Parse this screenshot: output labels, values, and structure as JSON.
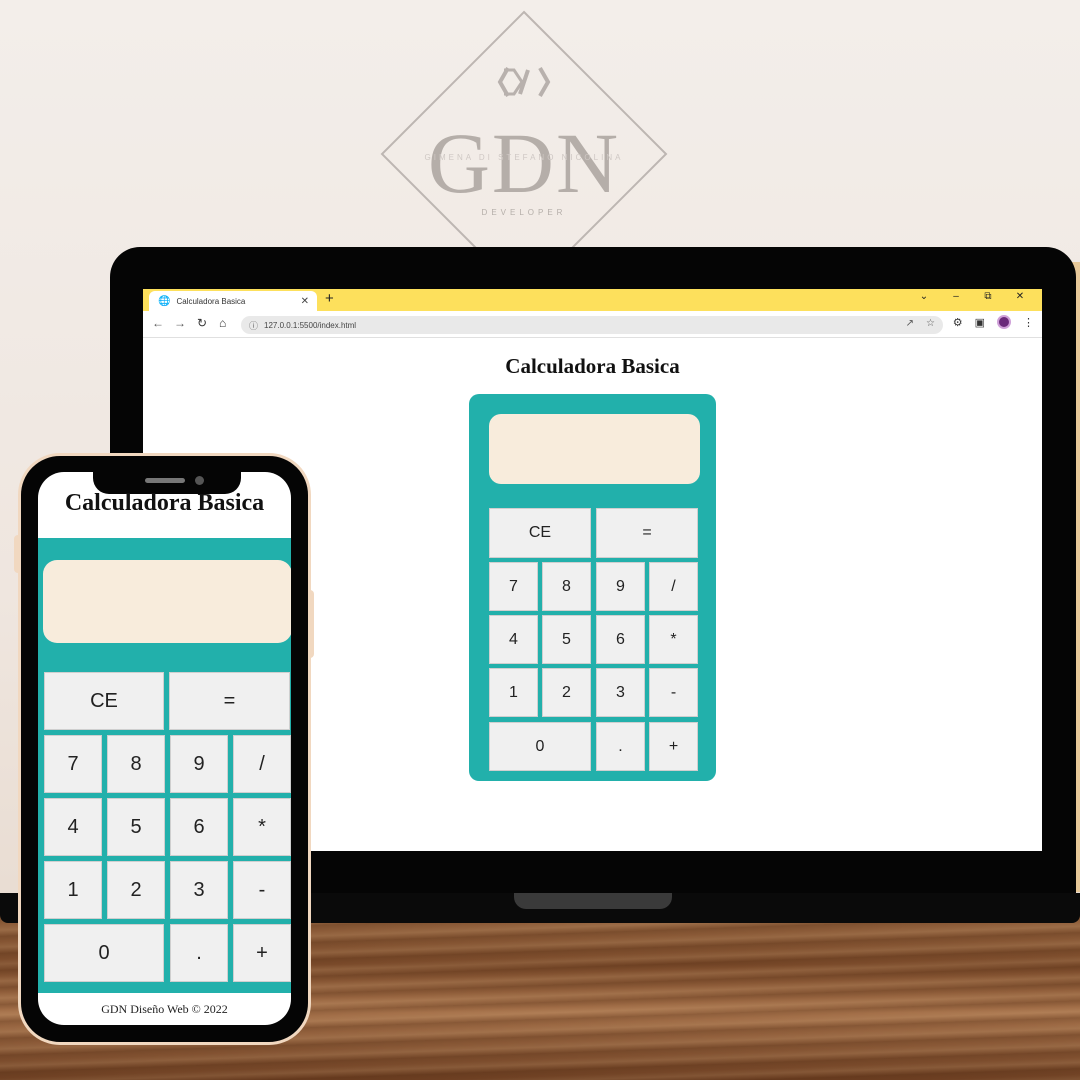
{
  "browser": {
    "tab_title": "Calculadora Basica",
    "url": "127.0.0.1:5500/index.html"
  },
  "laptop_page": {
    "title": "Calculadora Basica"
  },
  "phone_page": {
    "title": "Calculadora Basica",
    "footer": "GDN Diseño Web © 2022"
  },
  "keys": {
    "clear": "CE",
    "equals": "=",
    "seven": "7",
    "eight": "8",
    "nine": "9",
    "divide": "/",
    "four": "4",
    "five": "5",
    "six": "6",
    "multiply": "*",
    "one": "1",
    "two": "2",
    "three": "3",
    "minus": "-",
    "zero": "0",
    "dot": ".",
    "plus": "+"
  },
  "logo": {
    "letters": "GDN",
    "name": "GIMENA DI STEFANO NICOLINA",
    "role": "DEVELOPER"
  },
  "colors": {
    "calculator_body": "#22b0ab",
    "display": "#f8ecdc",
    "browser_tabbar": "#fde05c"
  }
}
